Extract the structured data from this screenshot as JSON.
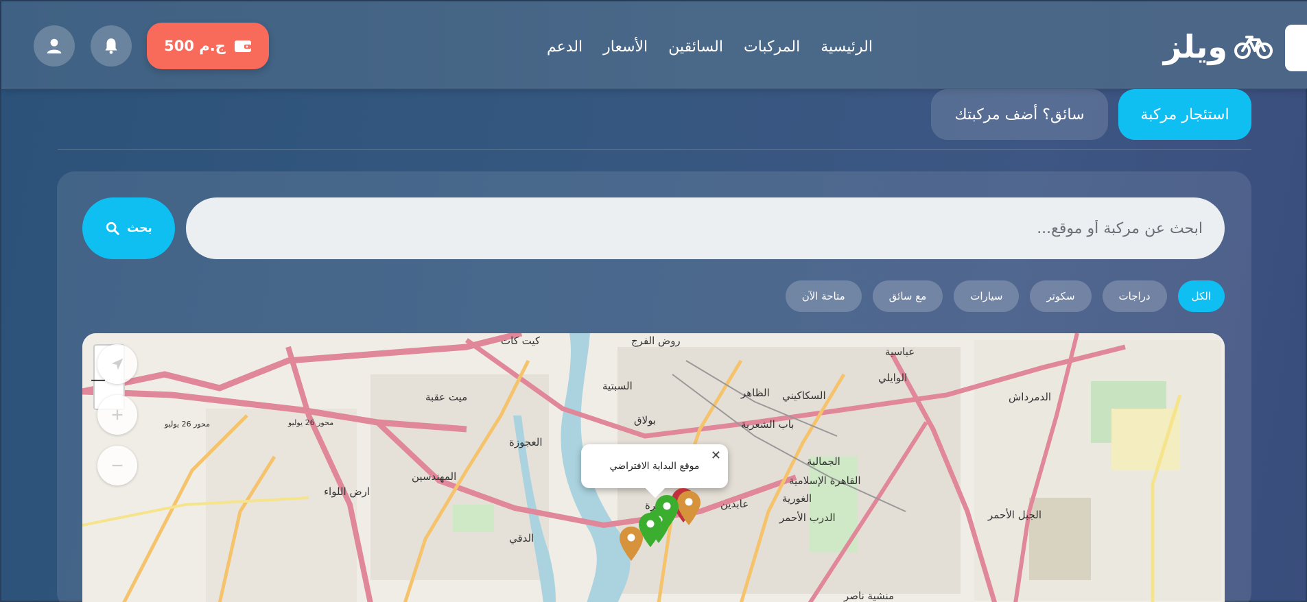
{
  "brand": {
    "name": "ويلز",
    "logo_icon": "bicycle-icon"
  },
  "nav": {
    "links": [
      "الرئيسية",
      "المركبات",
      "السائقين",
      "الأسعار",
      "الدعم"
    ]
  },
  "wallet": {
    "balance": "500 ج.م",
    "icon": "wallet-icon",
    "color": "#f86a5a"
  },
  "header_icons": {
    "notifications": "bell-icon",
    "profile": "user-icon"
  },
  "mode_tabs": {
    "rent": "استئجار مركبة",
    "driver": "سائق؟ أضف مركبتك"
  },
  "search": {
    "placeholder": "ابحث عن مركبة أو موقع...",
    "value": "",
    "button_label": "بحث",
    "button_icon": "search-icon"
  },
  "filters": {
    "chips": [
      "الكل",
      "دراجات",
      "سكوتر",
      "سيارات",
      "مع سائق",
      "متاحة الآن"
    ],
    "active": "الكل"
  },
  "map": {
    "popup_text": "موقع البداية الافتراضي",
    "labels": {
      "rod_elfarag": "روض الفرج",
      "kit_kat": "كيت كات",
      "abbasiya": "عباسية",
      "waili": "الوايلي",
      "sabtiya": "السبتية",
      "dhaher": "الظاهر",
      "sakakini": "السكاكيني",
      "mit_oqba": "ميت عقبة",
      "bulaq": "بولاق",
      "bab_shaariya": "باب الشعرية",
      "agouza": "العجوزة",
      "mohandessin": "المهندسين",
      "gamaliya": "الجمالية",
      "islamic_cairo": "القاهرة الإسلامية",
      "ghouriya": "الغورية",
      "darb_ahmar": "الدرب الأحمر",
      "ard_ellewa": "ارض اللواء",
      "dokki": "الدقي",
      "cairo": "القاهرة",
      "abdeen": "عابدين",
      "mansheya": "منشية ناصر",
      "demerdash": "الدمرداش",
      "gabal_ahmar": "الجبل الأحمر",
      "road_26july": "محور 26 يوليو",
      "road_26july_2": "محور 26 يوليو"
    },
    "accent": "#10bff2",
    "pin_colors": [
      "#3cae2f",
      "#c0303c",
      "#d6933b"
    ]
  }
}
